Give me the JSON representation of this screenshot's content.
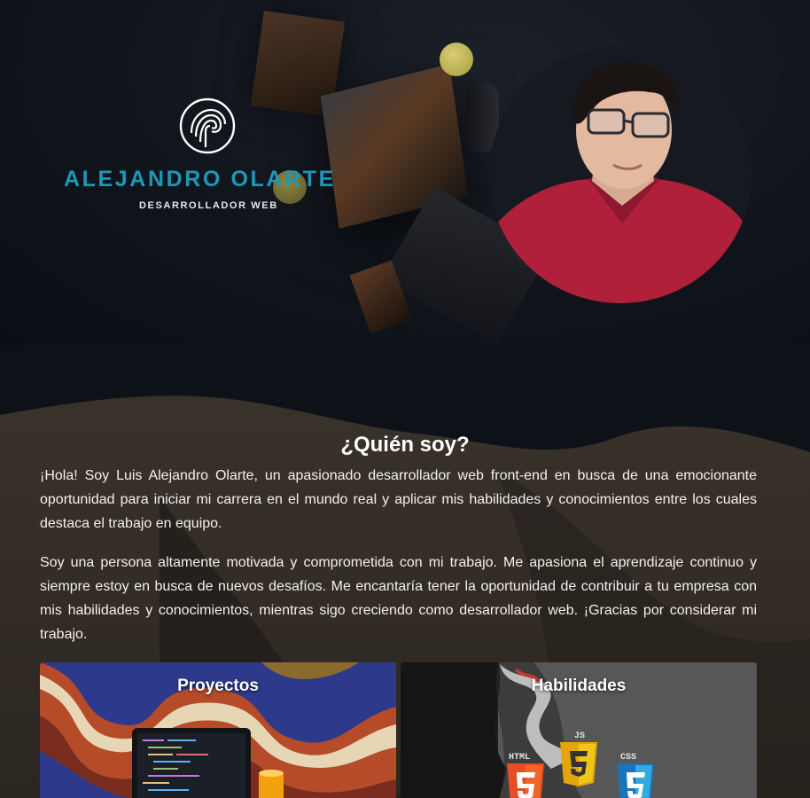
{
  "hero": {
    "brand_name": "ALEJANDRO OLARTE",
    "brand_role": "DESARROLLADOR WEB",
    "logo_icon": "fingerprint-logo-icon",
    "portrait_alt": "Foto de Alejandro Olarte"
  },
  "about": {
    "title": "¿Quién soy?",
    "paragraph_1": "¡Hola! Soy Luis Alejandro Olarte, un apasionado desarrollador web front-end en busca de una emocionante oportunidad para iniciar mi carrera en el mundo real y aplicar mis habilidades y conocimientos entre los cuales destaca el trabajo en equipo.",
    "paragraph_2": "Soy una persona altamente motivada y comprometida con mi trabajo. Me apasiona el aprendizaje continuo y siempre estoy en busca de nuevos desafíos. Me encantaría tener la oportunidad de contribuir a tu empresa con mis habilidades y conocimientos, mientras sigo creciendo como desarrollador web. ¡Gracias por considerar mi trabajo."
  },
  "cards": {
    "projects_title": "Proyectos",
    "skills_title": "Habilidades",
    "skill_badges": [
      "HTML",
      "JS",
      "CSS"
    ]
  },
  "colors": {
    "brand_accent": "#1f97b8",
    "background": "#0d1219",
    "html_orange": "#e44d26",
    "js_yellow": "#f0c419",
    "css_blue": "#1b73ba"
  }
}
